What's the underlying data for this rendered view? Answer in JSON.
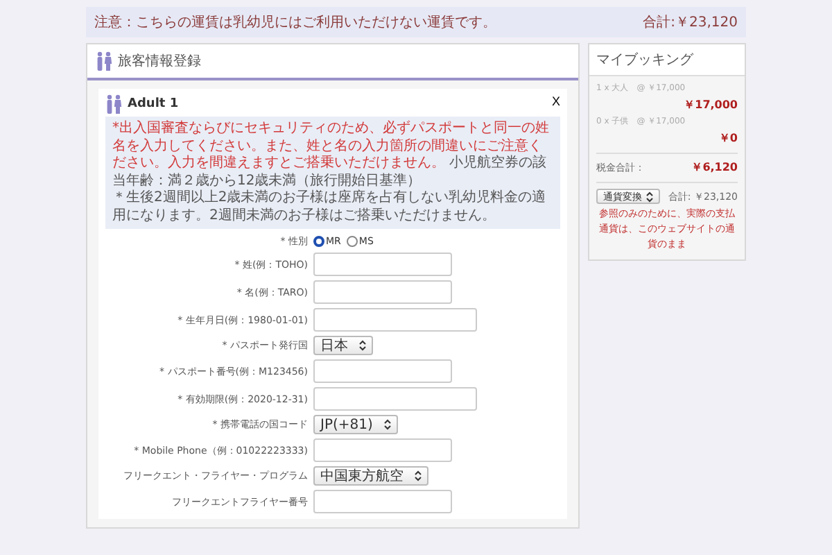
{
  "notice": {
    "text": "注意：こちらの運賃は乳幼児にはご利用いただけない運賃です。",
    "total": "合計:￥23,120"
  },
  "passenger_panel": {
    "title": "旅客情報登録",
    "adult": {
      "title": "Adult 1",
      "close": "X",
      "note": {
        "warning": "*出入国審査ならびにセキュリティのため、必ずパスポートと同一の姓名を入力してください。また、姓と名の入力箇所の間違いにご注意ください。入力を間違えますとご搭乗いただけません。",
        "info": "小児航空券の該当年齢：満２歳から12歳未満（旅行開始日基準）",
        "infant": "＊生後2週間以上2歳未満のお子様は座席を占有しない乳幼児料金の適用になります。2週間未満のお子様はご搭乗いただけません。"
      },
      "fields": [
        {
          "kind": "radio",
          "label": "* 性別",
          "options": [
            {
              "label": "MR",
              "selected": true
            },
            {
              "label": "MS",
              "selected": false
            }
          ]
        },
        {
          "kind": "text",
          "label": "* 姓(例：TOHO)",
          "wide": false
        },
        {
          "kind": "text",
          "label": "* 名(例：TARO)",
          "wide": false
        },
        {
          "kind": "text",
          "label": "* 生年月日(例：1980-01-01)",
          "wide": true
        },
        {
          "kind": "select",
          "label": "* パスポート発行国",
          "value": "日本"
        },
        {
          "kind": "text",
          "label": "* パスポート番号(例：M123456)",
          "wide": false
        },
        {
          "kind": "text",
          "label": "* 有効期限(例：2020-12-31)",
          "wide": true
        },
        {
          "kind": "select",
          "label": "* 携帯電話の国コード",
          "value": "JP(+81)"
        },
        {
          "kind": "text",
          "label": "* Mobile Phone（例：01022223333)",
          "wide": false
        },
        {
          "kind": "select",
          "label": "フリークエント・フライヤー・プログラム",
          "value": "中国東方航空"
        },
        {
          "kind": "text",
          "label": "フリークエントフライヤー番号",
          "wide": false
        }
      ]
    }
  },
  "booking": {
    "title": "マイブッキング",
    "items": [
      {
        "label": "1 x 大人",
        "unit": "@ ￥17,000",
        "amount": "￥17,000"
      },
      {
        "label": "0 x 子供",
        "unit": "@ ￥17,000",
        "amount": "￥0"
      }
    ],
    "tax": {
      "label": "税金合計：",
      "amount": "￥6,120"
    },
    "currency": "通貨変換",
    "total": "合計: ￥23,120",
    "disclaimer": "参照のみのために、実際の支払通貨は、このウェブサイトの通貨のまま"
  }
}
